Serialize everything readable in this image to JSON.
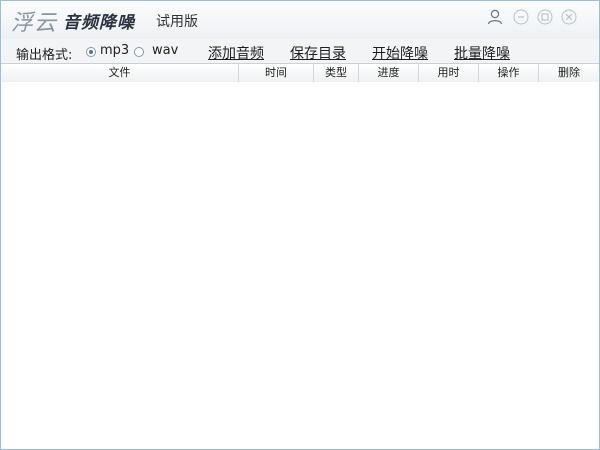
{
  "titlebar": {
    "logo_text": "浮云",
    "app_name": "音频降噪",
    "edition": "试用版",
    "icons": [
      "user-icon",
      "minimize-icon",
      "maximize-icon",
      "close-icon"
    ]
  },
  "toolbar": {
    "format_label": "输出格式:",
    "formats": [
      {
        "label": "mp3",
        "selected": true
      },
      {
        "label": "wav",
        "selected": false
      }
    ],
    "add_audio": "添加音频",
    "save_dir": "保存目录",
    "start_denoise": "开始降噪",
    "batch_denoise": "批量降噪"
  },
  "table": {
    "columns": [
      "文件",
      "时间",
      "类型",
      "进度",
      "用时",
      "操作",
      "删除"
    ],
    "rows": []
  },
  "colors": {
    "accent": "#3b78c3",
    "border": "#9cbfd9",
    "title_bg": "#eef1f4"
  }
}
